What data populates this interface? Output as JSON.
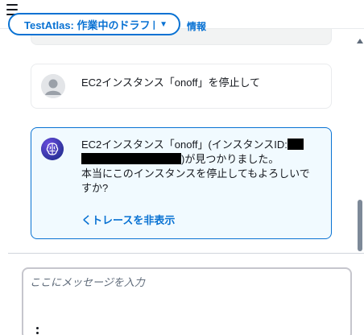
{
  "header": {
    "agent_select_label": "TestAtlas: 作業中のドラフト",
    "info_link": "情報"
  },
  "messages": {
    "user": {
      "text": "EC2インスタンス「onoff」を停止して"
    },
    "agent": {
      "line1": "EC2インスタンス「onoff」(インスタンスID:",
      "line2_suffix": ")が見つかりました。",
      "line3": "本当にこのインスタンスを停止してもよろしいですか?",
      "trace_link": "くトレースを非表示"
    }
  },
  "composer": {
    "placeholder": "ここにメッセージを入力",
    "value": ""
  },
  "colors": {
    "accent": "#0972d3",
    "agent_bubble_bg": "#f1faff",
    "agent_avatar": "#3a3bb0"
  },
  "icons": [
    "menu-icon",
    "chevron-down-icon",
    "user-avatar-icon",
    "brain-icon",
    "scroll-up-icon",
    "more-vertical-icon"
  ]
}
